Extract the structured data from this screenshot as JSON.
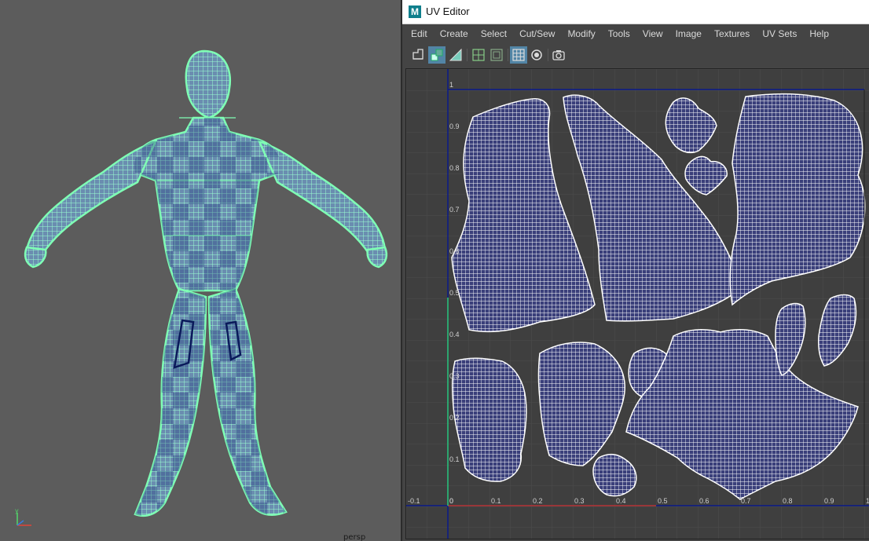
{
  "viewport": {
    "camera_label": "persp",
    "axis": {
      "x": "x",
      "y": "y",
      "z": "z"
    },
    "wire_color": "#7fffb5"
  },
  "uv_editor": {
    "title": "UV Editor",
    "logo": "M",
    "menu": [
      "Edit",
      "Create",
      "Select",
      "Cut/Sew",
      "Modify",
      "Tools",
      "View",
      "Image",
      "Textures",
      "UV Sets",
      "Help"
    ],
    "toolbar_icons": [
      "uv-shell-icon",
      "uv-select-shell-icon",
      "shaded-uv-icon",
      "grid-icon",
      "texture-borders-icon",
      "checker-toggle-icon",
      "isolate-icon",
      "snapshot-icon"
    ],
    "x_ticks": [
      "-0.1",
      "0",
      "0.1",
      "0.2",
      "0.3",
      "0.4",
      "0.5",
      "0.6",
      "0.7",
      "0.8",
      "0.9",
      "1"
    ],
    "y_ticks": [
      "1",
      "0.9",
      "0.8",
      "0.7",
      "0.6",
      "0.5",
      "0.4",
      "0.3",
      "0.2",
      "0.1",
      "0"
    ],
    "u_axis_color": "#c0392b",
    "v_axis_color": "#2ecc71",
    "boundary_color": "#0a1a8a"
  }
}
